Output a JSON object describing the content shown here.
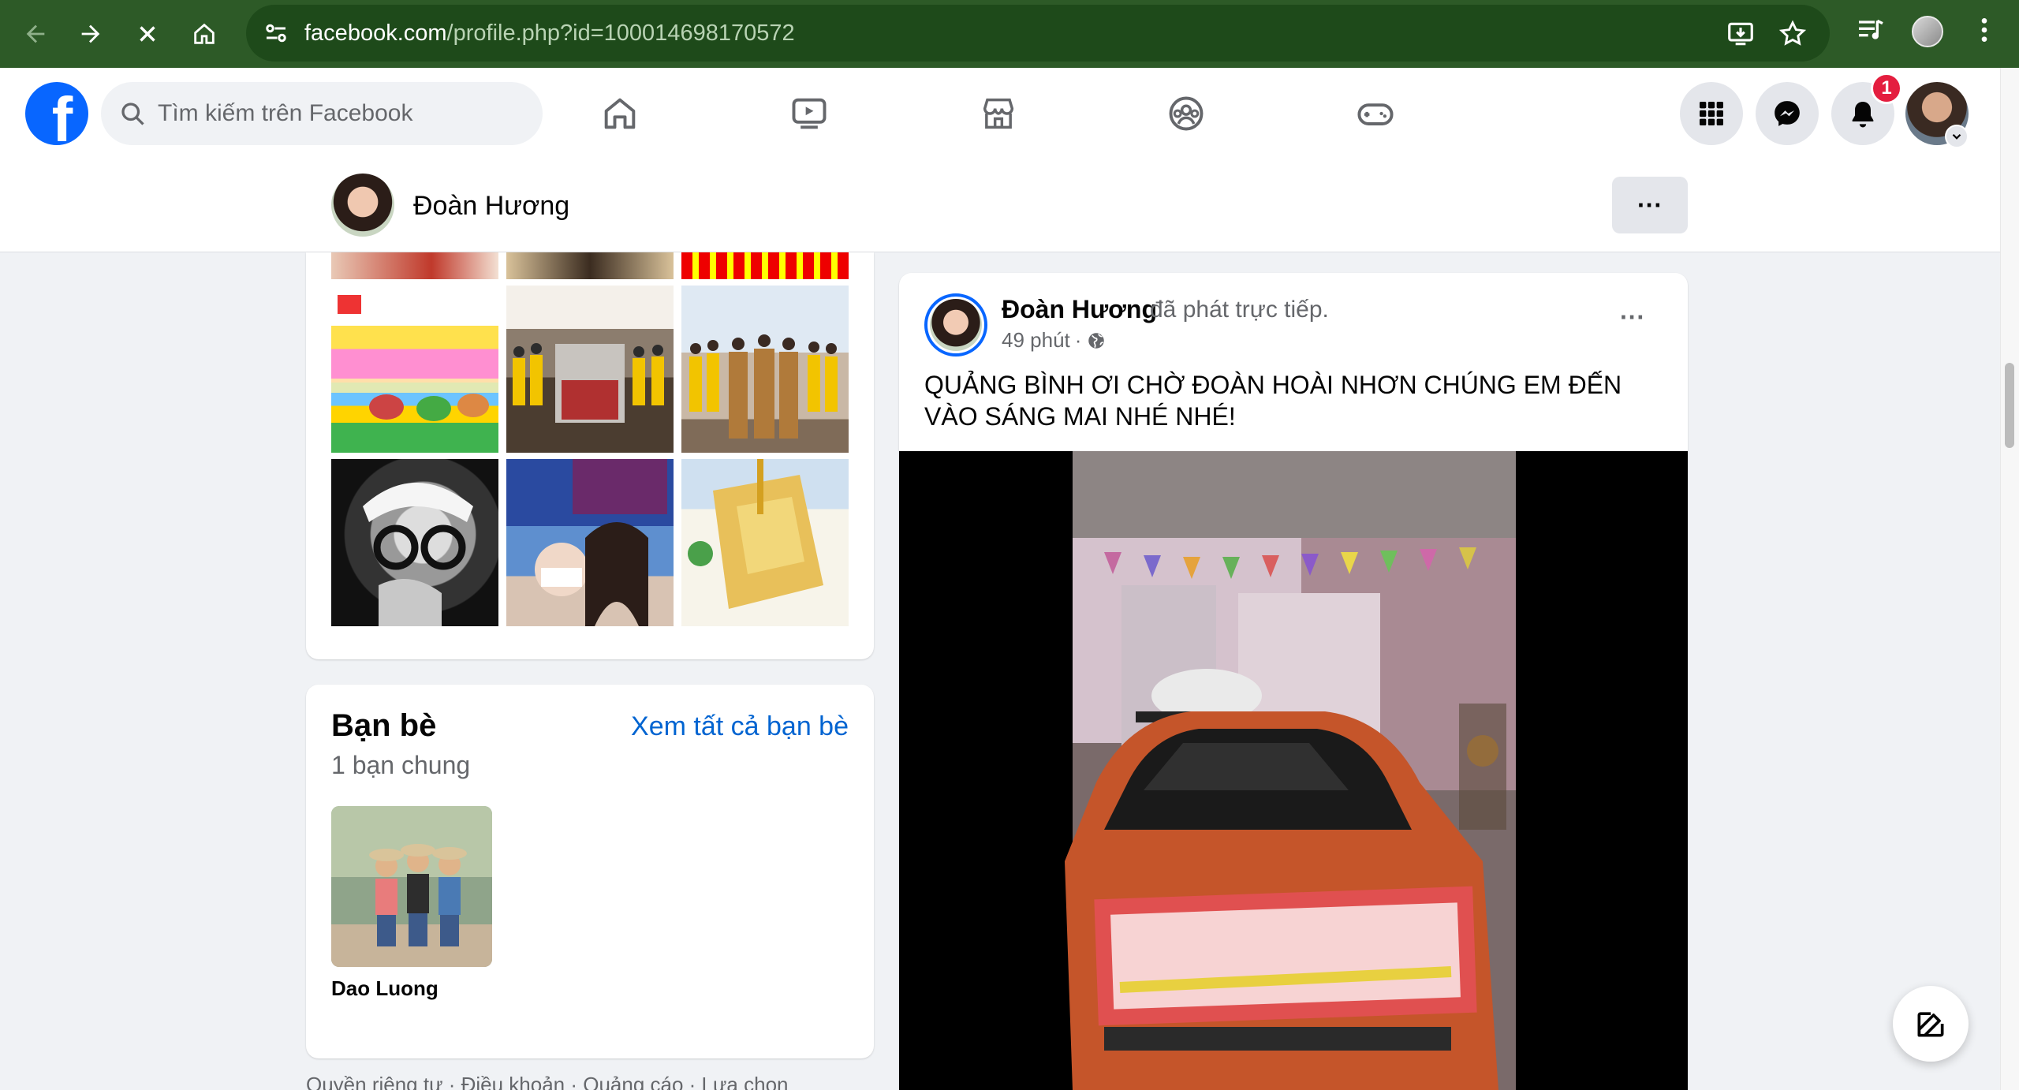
{
  "browser": {
    "url_host": "facebook.com",
    "url_path": "/profile.php?id=100014698170572",
    "icons": [
      "back-icon",
      "forward-icon",
      "stop-icon",
      "home-icon",
      "site-settings-icon",
      "install-icon",
      "bookmark-star-icon",
      "media-icon",
      "profile-icon",
      "menu-icon"
    ]
  },
  "fb_nav": {
    "search_placeholder": "Tìm kiếm trên Facebook",
    "tabs": [
      "home-tab",
      "video-tab",
      "marketplace-tab",
      "groups-tab",
      "gaming-tab"
    ],
    "notification_count": "1",
    "brand_color": "#0866ff"
  },
  "profile_bar": {
    "name": "Đoàn Hương",
    "more_label": "···"
  },
  "friends": {
    "title": "Bạn bè",
    "see_all": "Xem tất cả bạn bè",
    "mutual": "1 bạn chung",
    "items": [
      {
        "name": "Dao Luong"
      }
    ]
  },
  "footer_peek": "Quyền riêng tư · Điều khoản · Quảng cáo · Lựa chọn",
  "post": {
    "author": "Đoàn Hương",
    "action": "đã phát trực tiếp.",
    "time": "49 phút",
    "dot": "·",
    "more_label": "···",
    "text": "QUẢNG BÌNH ƠI CHỜ ĐOÀN HOÀI NHƠN CHÚNG EM ĐẾN VÀO SÁNG MAI NHÉ NHÉ!"
  }
}
